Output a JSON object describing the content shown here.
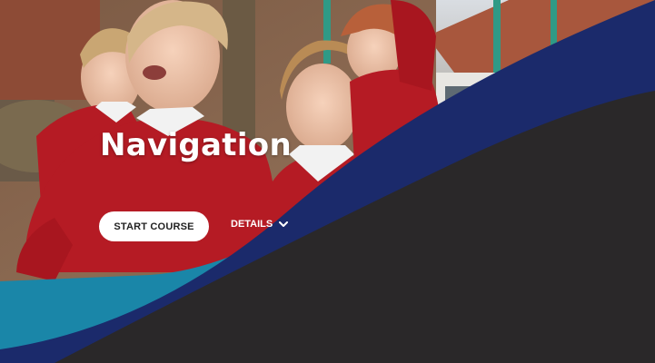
{
  "hero": {
    "title": "Navigation",
    "start_button_label": "START COURSE",
    "details_label": "DETAILS"
  },
  "icons": {
    "details_toggle": "chevron-down-icon"
  },
  "colors": {
    "navy_band": "#1b2a6b",
    "teal_band": "#1a86a8",
    "dark_panel": "#2a2829",
    "sweater_red": "#b51b24"
  }
}
